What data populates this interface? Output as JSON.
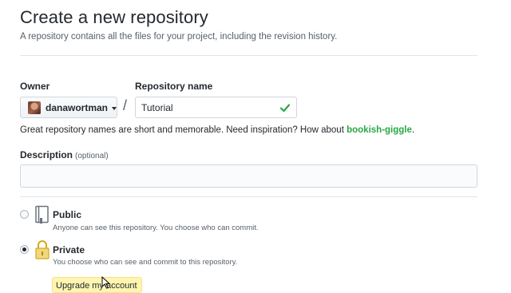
{
  "page": {
    "title": "Create a new repository",
    "subtitle": "A repository contains all the files for your project, including the revision history."
  },
  "owner": {
    "label": "Owner",
    "username": "danawortman"
  },
  "repo_name": {
    "label": "Repository name",
    "value": "Tutorial",
    "separator": "/"
  },
  "hint": {
    "text": "Great repository names are short and memorable. Need inspiration? How about ",
    "suggestion": "bookish-giggle",
    "end": "."
  },
  "description": {
    "label": "Description",
    "optional": "(optional)",
    "value": ""
  },
  "visibility": {
    "selected": "private",
    "options": [
      {
        "id": "public",
        "title": "Public",
        "desc": "Anyone can see this repository. You choose who can commit."
      },
      {
        "id": "private",
        "title": "Private",
        "desc": "You choose who can see and commit to this repository."
      }
    ]
  },
  "upgrade": {
    "label": "Upgrade my account"
  },
  "colors": {
    "success": "#28a745",
    "text": "#24292e",
    "muted": "#586069",
    "upgrade_bg": "#fff5b1"
  },
  "icons": [
    "check-icon",
    "book-icon",
    "lock-icon",
    "caret-down-icon",
    "mouse-cursor-icon"
  ]
}
